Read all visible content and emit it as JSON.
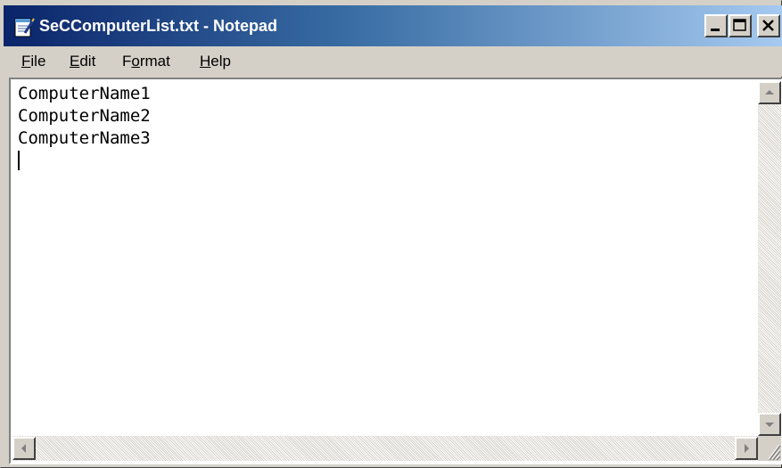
{
  "window": {
    "title": "SeCComputerList.txt - Notepad",
    "accent": "#0a246a",
    "app_icon": "notepad-icon"
  },
  "caption_buttons": {
    "minimize_icon": "minimize-icon",
    "maximize_icon": "maximize-icon",
    "close_icon": "close-icon"
  },
  "menu": {
    "file": {
      "mnemonic": "F",
      "rest": "ile"
    },
    "edit": {
      "mnemonic": "E",
      "rest": "dit"
    },
    "format": {
      "pre": "F",
      "mnemonic": "o",
      "rest": "rmat"
    },
    "help": {
      "mnemonic": "H",
      "rest": "elp"
    }
  },
  "editor": {
    "lines": [
      "ComputerName1",
      "ComputerName2",
      "ComputerName3"
    ]
  },
  "scrollbars": {
    "up_icon": "arrow-up-icon",
    "down_icon": "arrow-down-icon",
    "left_icon": "arrow-left-icon",
    "right_icon": "arrow-right-icon",
    "grip_icon": "size-grip-icon"
  }
}
